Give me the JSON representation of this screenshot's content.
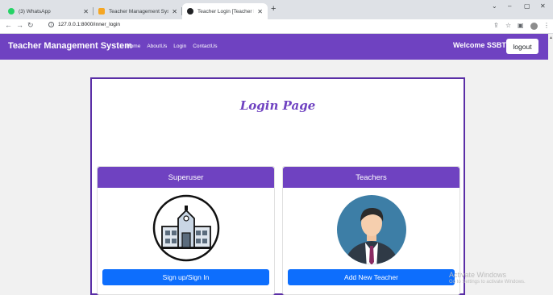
{
  "browser": {
    "tabs": [
      {
        "title": "(3) WhatsApp",
        "active": false,
        "color": "#25d366"
      },
      {
        "title": "Teacher Management System - ...",
        "active": false,
        "color": "#f5a623"
      },
      {
        "title": "Teacher Login [Teacher Manager",
        "active": true,
        "color": "#202124"
      }
    ],
    "new_tab": "+",
    "url": "127.0.0.1:8000/inner_login"
  },
  "navbar": {
    "brand": "Teacher Management System",
    "links": [
      "Home",
      "AboutUs",
      "Login",
      "ContactUs"
    ],
    "welcome": "Welcome SSBT",
    "logout": "logout",
    "color": "#6f42c1"
  },
  "main": {
    "title": "Login Page",
    "cards": [
      {
        "header": "Superuser",
        "button": "Sign up/Sign In",
        "icon": "school-building-icon"
      },
      {
        "header": "Teachers",
        "button": "Add New Teacher",
        "icon": "teacher-avatar-icon"
      }
    ]
  },
  "watermark": {
    "line1": "Activate Windows",
    "line2": "Go to Settings to activate Windows."
  }
}
